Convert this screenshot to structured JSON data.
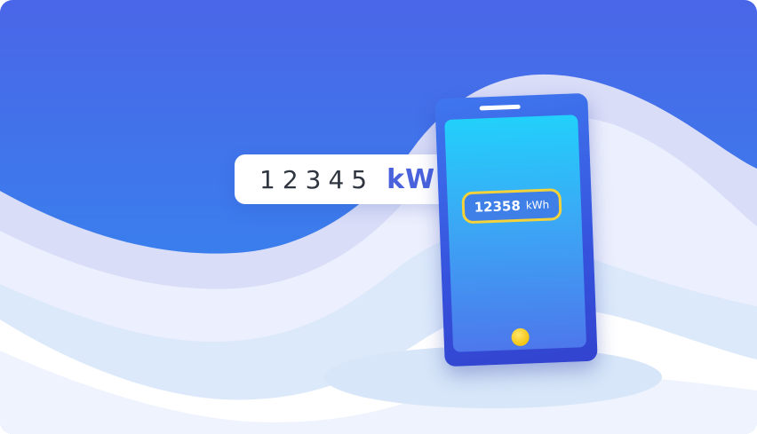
{
  "meter_card": {
    "digits": "12345",
    "unit": "kW"
  },
  "phone": {
    "reading_value": "12358",
    "reading_unit": "kWh"
  },
  "colors": {
    "sky_top": "#4a66e8",
    "sky_bottom": "#2f8ff0",
    "accent_blue": "#4a62dc",
    "highlight_yellow": "#f4d23a",
    "phone_body": "#3653dd"
  }
}
